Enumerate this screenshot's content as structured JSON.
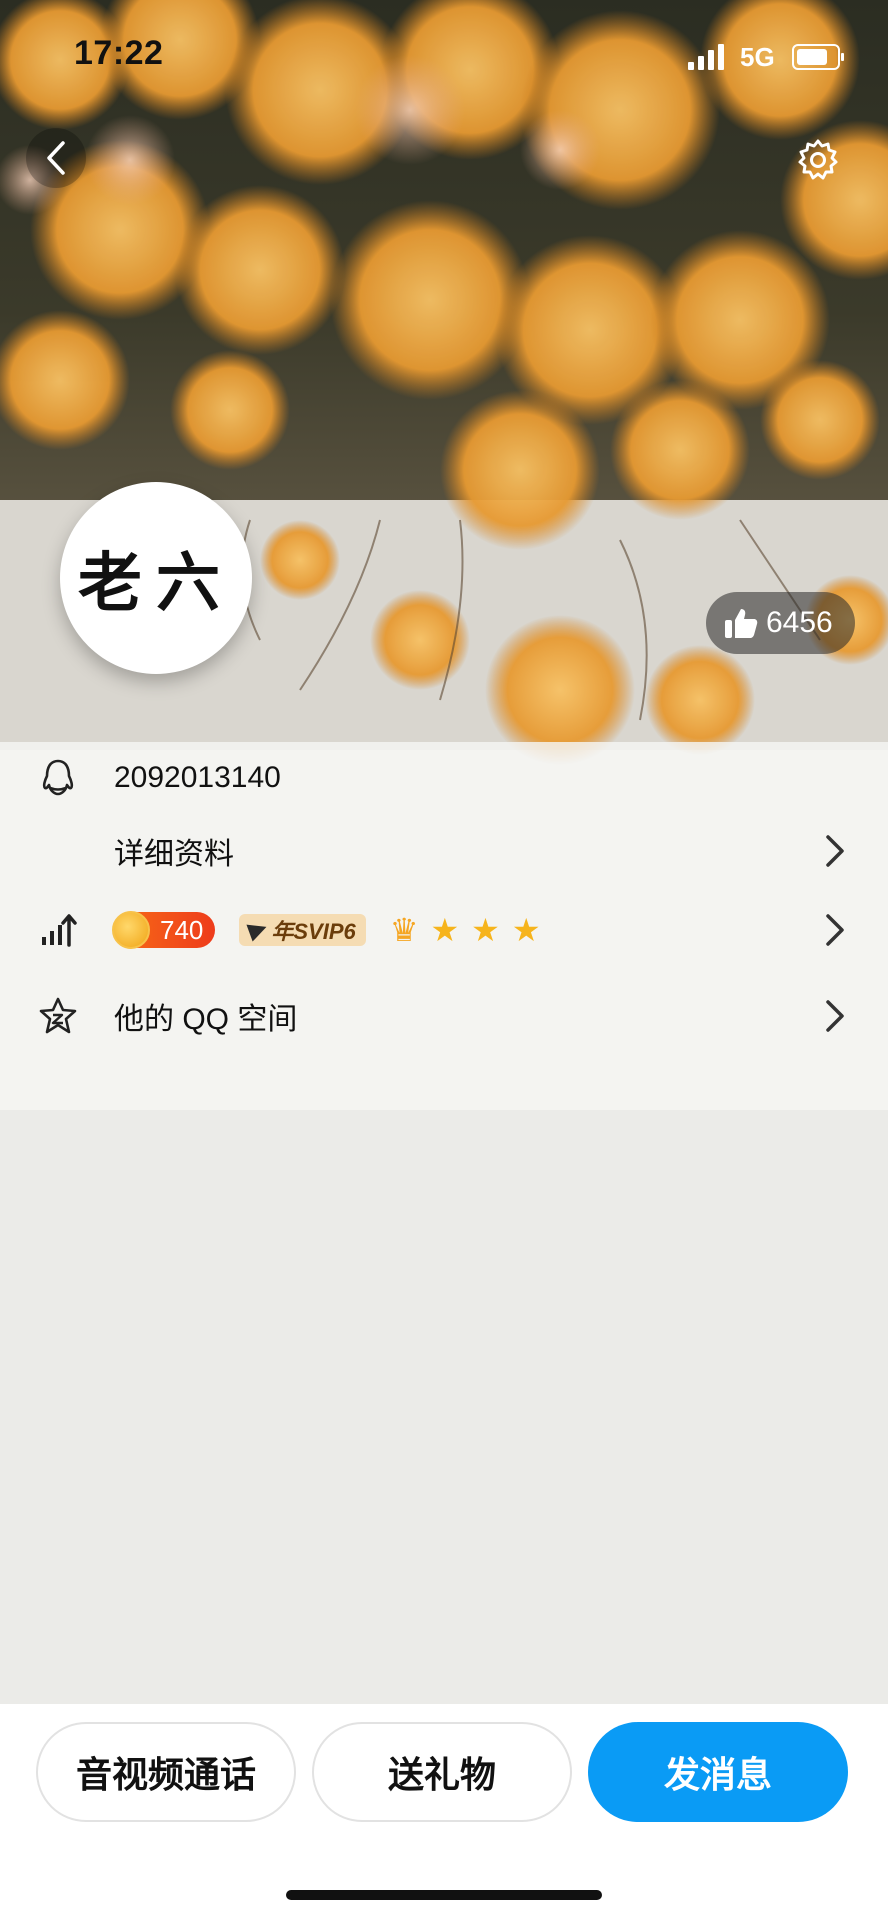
{
  "status_bar": {
    "time": "17:22",
    "network": "5G"
  },
  "header": {
    "back_icon": "chevron-left-icon",
    "settings_icon": "gear-icon"
  },
  "profile": {
    "avatar_text": "老六",
    "likes": "6456",
    "qq_number": "2092013140",
    "detail_label": "详细资料",
    "level_value": "740",
    "svip_label": "年SVIP6",
    "stars": 3,
    "qzone_label": "他的 QQ 空间"
  },
  "actions": {
    "call": "音视频通话",
    "gift": "送礼物",
    "message": "发消息"
  },
  "colors": {
    "accent": "#0a9bf5",
    "coin": "#ee3c1b",
    "gold": "#f6b41c"
  }
}
